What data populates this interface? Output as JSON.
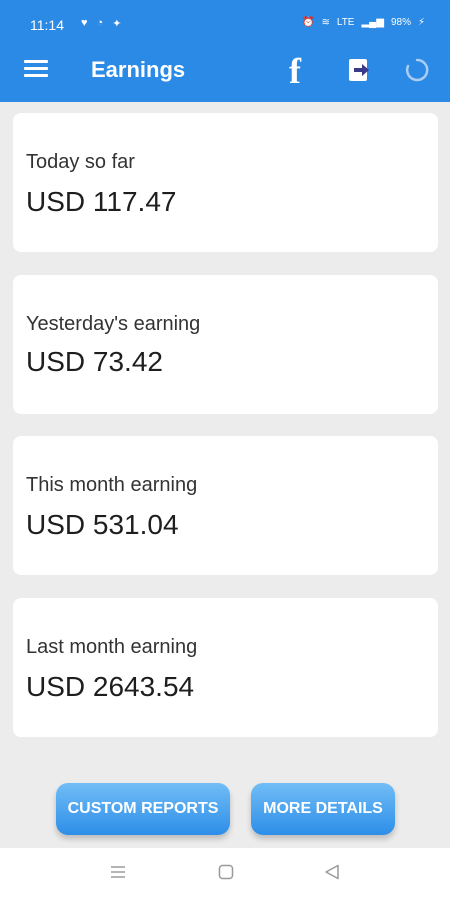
{
  "status_bar": {
    "time": "11:14",
    "battery": "98%"
  },
  "app_bar": {
    "title": "Earnings"
  },
  "cards": [
    {
      "label": "Today so far",
      "value": "USD 117.47"
    },
    {
      "label": "Yesterday's earning",
      "value": "USD 73.42"
    },
    {
      "label": "This month earning",
      "value": "USD 531.04"
    },
    {
      "label": "Last month earning",
      "value": "USD 2643.54"
    }
  ],
  "buttons": {
    "custom_reports": "CUSTOM REPORTS",
    "more_details": "MORE DETAILS"
  },
  "colors": {
    "primary": "#2b8ae6",
    "background": "#ececec",
    "card": "#ffffff",
    "button_top": "#71bdf6",
    "button_bottom": "#2d8ee8"
  },
  "icons": [
    "menu-icon",
    "facebook-icon",
    "logout-icon",
    "refresh-icon",
    "recent-apps-icon",
    "home-icon",
    "back-icon"
  ]
}
